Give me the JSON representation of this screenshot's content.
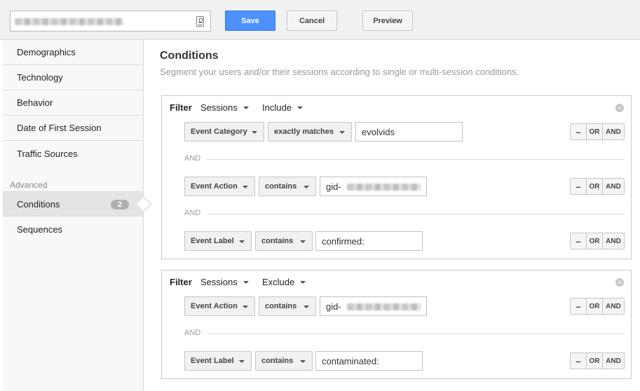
{
  "topbar": {
    "segment_name_value": "",
    "save_label": "Save",
    "cancel_label": "Cancel",
    "preview_label": "Preview"
  },
  "sidebar": {
    "items": [
      {
        "label": "Demographics"
      },
      {
        "label": "Technology"
      },
      {
        "label": "Behavior"
      },
      {
        "label": "Date of First Session"
      },
      {
        "label": "Traffic Sources"
      }
    ],
    "advanced_heading": "Advanced",
    "advanced_items": [
      {
        "label": "Conditions",
        "badge": "2"
      },
      {
        "label": "Sequences"
      }
    ]
  },
  "main": {
    "title": "Conditions",
    "description": "Segment your users and/or their sessions according to single or multi-session conditions."
  },
  "filters": [
    {
      "label": "Filter",
      "scope": "Sessions",
      "mode": "Include",
      "conditions": [
        {
          "dimension": "Event Category",
          "operator": "exactly matches",
          "value": "evolvids"
        },
        {
          "dimension": "Event Action",
          "operator": "contains",
          "value": "gid-"
        },
        {
          "dimension": "Event Label",
          "operator": "contains",
          "value": "confirmed:"
        }
      ]
    },
    {
      "label": "Filter",
      "scope": "Sessions",
      "mode": "Exclude",
      "conditions": [
        {
          "dimension": "Event Action",
          "operator": "contains",
          "value": "gid-"
        },
        {
          "dimension": "Event Label",
          "operator": "contains",
          "value": "contaminated:"
        }
      ]
    }
  ],
  "labels": {
    "and_separator": "AND",
    "minus": "–",
    "or": "OR",
    "and": "AND",
    "remove": "×"
  }
}
